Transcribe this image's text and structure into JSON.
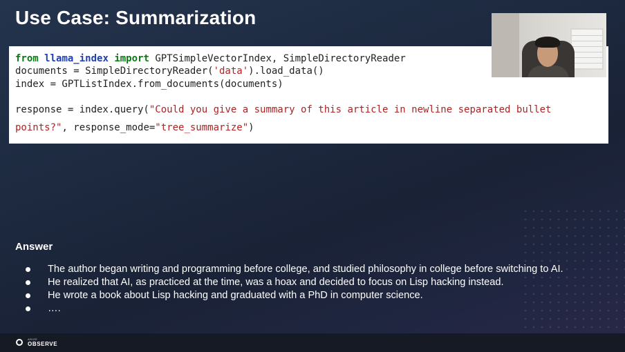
{
  "slide": {
    "title": "Use Case: Summarization"
  },
  "code": {
    "lines": [
      {
        "kw1": "from",
        "mod": "llama_index",
        "kw2": "import",
        "rest": "GPTSimpleVectorIndex, SimpleDirectoryReader"
      },
      {
        "pre": "documents = SimpleDirectoryReader(",
        "str": "'data'",
        "post": ").load_data()"
      },
      {
        "text": "index = GPTListIndex.from_documents(documents)"
      },
      {
        "pre": "response = index.query(",
        "str": "\"Could you give a summary of this article in newline separated bullet"
      },
      {
        "str": "points?\"",
        "mid": ", response_mode=",
        "str2": "\"tree_summarize\"",
        "post": ")"
      }
    ]
  },
  "answer": {
    "title": "Answer",
    "bullets": [
      "The author began writing and programming before college, and studied philosophy in college before switching to AI.",
      "He realized that AI, as practiced at the time, was a hoax and decided to focus on Lisp hacking instead.",
      "He wrote a book about Lisp hacking and graduated with a PhD in computer science.",
      "…."
    ]
  },
  "footer": {
    "logo_small": "ARIZE",
    "logo_text": "OBSERVE"
  },
  "colors": {
    "keyword": "#0a7a12",
    "module": "#1f3fb5",
    "string": "#b02222",
    "background": "#1d2a40"
  }
}
